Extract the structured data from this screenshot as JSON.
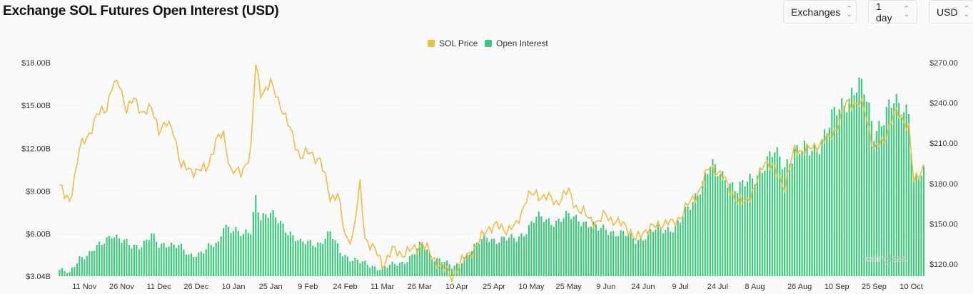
{
  "header": {
    "title": "Exchange SOL Futures Open Interest (USD)",
    "exchanges_label": "Exchanges",
    "interval_label": "1 day",
    "currency_label": "USD"
  },
  "watermark": "coinglass",
  "colors": {
    "price": "#f0bc44",
    "oi": "#3cc97c",
    "grid": "#eeeeee"
  },
  "chart_data": {
    "type": "bar",
    "title": "Exchange SOL Futures Open Interest (USD)",
    "legend": {
      "placement": "top-center",
      "entries": [
        "SOL Price",
        "Open Interest"
      ]
    },
    "grid": true,
    "x_tick_labels": [
      "11 Nov",
      "26 Nov",
      "11 Dec",
      "26 Dec",
      "10 Jan",
      "25 Jan",
      "9 Feb",
      "24 Feb",
      "11 Mar",
      "26 Mar",
      "10 Apr",
      "25 Apr",
      "10 May",
      "25 May",
      "9 Jun",
      "24 Jun",
      "9 Jul",
      "24 Jul",
      "8 Aug",
      "26 Aug",
      "10 Sep",
      "25 Sep",
      "10 Oct"
    ],
    "y_left": {
      "label": "",
      "ticks": [
        "$3.04B",
        "$6.00B",
        "$9.00B",
        "$12.00B",
        "$15.00B",
        "$18.00B"
      ],
      "range": [
        3.04,
        18.0
      ],
      "unit": "B USD"
    },
    "y_right": {
      "label": "",
      "ticks": [
        "$120.00",
        "$150.00",
        "$180.00",
        "$210.00",
        "$240.00",
        "$270.00"
      ],
      "range": [
        111,
        270
      ],
      "unit": "USD"
    },
    "series": [
      {
        "name": "Open Interest",
        "type": "bar",
        "axis": "left",
        "keyframes": [
          [
            "2024-11-01",
            3.5
          ],
          [
            "2024-11-05",
            3.2
          ],
          [
            "2024-11-09",
            4.4
          ],
          [
            "2024-11-13",
            4.6
          ],
          [
            "2024-11-18",
            5.3
          ],
          [
            "2024-11-22",
            6.1
          ],
          [
            "2024-11-26",
            5.5
          ],
          [
            "2024-11-30",
            5.1
          ],
          [
            "2024-12-04",
            5.3
          ],
          [
            "2024-12-08",
            5.9
          ],
          [
            "2024-12-11",
            5.1
          ],
          [
            "2024-12-15",
            5.4
          ],
          [
            "2024-12-19",
            5.2
          ],
          [
            "2024-12-23",
            4.4
          ],
          [
            "2024-12-27",
            4.7
          ],
          [
            "2024-12-31",
            5.1
          ],
          [
            "2025-01-04",
            5.2
          ],
          [
            "2025-01-06",
            6.7
          ],
          [
            "2025-01-10",
            6.4
          ],
          [
            "2025-01-14",
            5.8
          ],
          [
            "2025-01-17",
            6.2
          ],
          [
            "2025-01-19",
            8.7
          ],
          [
            "2025-01-21",
            7.3
          ],
          [
            "2025-01-25",
            7.3
          ],
          [
            "2025-01-29",
            6.8
          ],
          [
            "2025-02-02",
            6.1
          ],
          [
            "2025-02-06",
            5.3
          ],
          [
            "2025-02-10",
            5.4
          ],
          [
            "2025-02-14",
            5.4
          ],
          [
            "2025-02-18",
            6.0
          ],
          [
            "2025-02-22",
            4.8
          ],
          [
            "2025-02-26",
            4.3
          ],
          [
            "2025-03-02",
            4.0
          ],
          [
            "2025-03-06",
            3.8
          ],
          [
            "2025-03-11",
            3.6
          ],
          [
            "2025-03-15",
            3.8
          ],
          [
            "2025-03-19",
            4.0
          ],
          [
            "2025-03-23",
            4.5
          ],
          [
            "2025-03-27",
            5.3
          ],
          [
            "2025-03-31",
            4.4
          ],
          [
            "2025-04-04",
            4.2
          ],
          [
            "2025-04-08",
            3.6
          ],
          [
            "2025-04-10",
            3.8
          ],
          [
            "2025-04-14",
            4.6
          ],
          [
            "2025-04-18",
            5.2
          ],
          [
            "2025-04-22",
            5.8
          ],
          [
            "2025-04-26",
            5.6
          ],
          [
            "2025-04-30",
            5.6
          ],
          [
            "2025-05-04",
            5.7
          ],
          [
            "2025-05-08",
            6.3
          ],
          [
            "2025-05-12",
            7.1
          ],
          [
            "2025-05-16",
            7.0
          ],
          [
            "2025-05-20",
            6.9
          ],
          [
            "2025-05-25",
            7.2
          ],
          [
            "2025-05-29",
            7.1
          ],
          [
            "2025-06-02",
            6.7
          ],
          [
            "2025-06-06",
            6.3
          ],
          [
            "2025-06-09",
            6.4
          ],
          [
            "2025-06-13",
            6.1
          ],
          [
            "2025-06-17",
            5.9
          ],
          [
            "2025-06-21",
            5.6
          ],
          [
            "2025-06-24",
            5.8
          ],
          [
            "2025-06-28",
            6.2
          ],
          [
            "2025-07-02",
            6.3
          ],
          [
            "2025-07-06",
            6.5
          ],
          [
            "2025-07-09",
            6.9
          ],
          [
            "2025-07-13",
            7.9
          ],
          [
            "2025-07-17",
            9.4
          ],
          [
            "2025-07-21",
            10.8
          ],
          [
            "2025-07-24",
            10.2
          ],
          [
            "2025-07-28",
            9.9
          ],
          [
            "2025-08-01",
            9.1
          ],
          [
            "2025-08-04",
            9.4
          ],
          [
            "2025-08-08",
            10.1
          ],
          [
            "2025-08-12",
            10.9
          ],
          [
            "2025-08-16",
            11.6
          ],
          [
            "2025-08-20",
            10.9
          ],
          [
            "2025-08-24",
            11.8
          ],
          [
            "2025-08-26",
            11.7
          ],
          [
            "2025-08-30",
            11.9
          ],
          [
            "2025-09-03",
            12.4
          ],
          [
            "2025-09-07",
            13.5
          ],
          [
            "2025-09-10",
            14.6
          ],
          [
            "2025-09-14",
            15.6
          ],
          [
            "2025-09-18",
            16.2
          ],
          [
            "2025-09-21",
            15.9
          ],
          [
            "2025-09-25",
            13.4
          ],
          [
            "2025-09-29",
            14.1
          ],
          [
            "2025-10-03",
            15.1
          ],
          [
            "2025-10-06",
            15.0
          ],
          [
            "2025-10-09",
            14.9
          ],
          [
            "2025-10-11",
            9.6
          ],
          [
            "2025-10-15",
            10.2
          ]
        ]
      },
      {
        "name": "SOL Price",
        "type": "line",
        "axis": "right",
        "keyframes": [
          [
            "2024-11-01",
            179
          ],
          [
            "2024-11-03",
            170
          ],
          [
            "2024-11-05",
            167
          ],
          [
            "2024-11-07",
            185
          ],
          [
            "2024-11-09",
            205
          ],
          [
            "2024-11-13",
            218
          ],
          [
            "2024-11-16",
            230
          ],
          [
            "2024-11-20",
            237
          ],
          [
            "2024-11-22",
            252
          ],
          [
            "2024-11-25",
            254
          ],
          [
            "2024-11-28",
            236
          ],
          [
            "2024-12-01",
            242
          ],
          [
            "2024-12-04",
            234
          ],
          [
            "2024-12-08",
            235
          ],
          [
            "2024-12-11",
            221
          ],
          [
            "2024-12-14",
            224
          ],
          [
            "2024-12-17",
            219
          ],
          [
            "2024-12-20",
            193
          ],
          [
            "2024-12-23",
            190
          ],
          [
            "2024-12-26",
            190
          ],
          [
            "2024-12-30",
            190
          ],
          [
            "2025-01-03",
            212
          ],
          [
            "2025-01-06",
            216
          ],
          [
            "2025-01-09",
            190
          ],
          [
            "2025-01-13",
            187
          ],
          [
            "2025-01-17",
            204
          ],
          [
            "2025-01-19",
            268
          ],
          [
            "2025-01-21",
            248
          ],
          [
            "2025-01-25",
            254
          ],
          [
            "2025-01-29",
            239
          ],
          [
            "2025-02-02",
            219
          ],
          [
            "2025-02-06",
            200
          ],
          [
            "2025-02-10",
            203
          ],
          [
            "2025-02-14",
            197
          ],
          [
            "2025-02-18",
            170
          ],
          [
            "2025-02-21",
            172
          ],
          [
            "2025-02-24",
            140
          ],
          [
            "2025-02-27",
            140
          ],
          [
            "2025-03-02",
            178
          ],
          [
            "2025-03-04",
            140
          ],
          [
            "2025-03-08",
            130
          ],
          [
            "2025-03-11",
            120
          ],
          [
            "2025-03-15",
            130
          ],
          [
            "2025-03-19",
            128
          ],
          [
            "2025-03-23",
            130
          ],
          [
            "2025-03-27",
            136
          ],
          [
            "2025-03-31",
            125
          ],
          [
            "2025-04-04",
            118
          ],
          [
            "2025-04-08",
            111
          ],
          [
            "2025-04-10",
            116
          ],
          [
            "2025-04-14",
            127
          ],
          [
            "2025-04-18",
            133
          ],
          [
            "2025-04-22",
            147
          ],
          [
            "2025-04-26",
            148
          ],
          [
            "2025-04-30",
            146
          ],
          [
            "2025-05-04",
            148
          ],
          [
            "2025-05-08",
            170
          ],
          [
            "2025-05-12",
            172
          ],
          [
            "2025-05-16",
            170
          ],
          [
            "2025-05-20",
            166
          ],
          [
            "2025-05-25",
            174
          ],
          [
            "2025-05-29",
            160
          ],
          [
            "2025-06-02",
            155
          ],
          [
            "2025-06-06",
            150
          ],
          [
            "2025-06-09",
            158
          ],
          [
            "2025-06-13",
            150
          ],
          [
            "2025-06-17",
            150
          ],
          [
            "2025-06-21",
            137
          ],
          [
            "2025-06-24",
            145
          ],
          [
            "2025-06-28",
            147
          ],
          [
            "2025-07-02",
            151
          ],
          [
            "2025-07-06",
            150
          ],
          [
            "2025-07-09",
            156
          ],
          [
            "2025-07-13",
            166
          ],
          [
            "2025-07-17",
            176
          ],
          [
            "2025-07-21",
            194
          ],
          [
            "2025-07-24",
            188
          ],
          [
            "2025-07-28",
            180
          ],
          [
            "2025-08-01",
            165
          ],
          [
            "2025-08-04",
            167
          ],
          [
            "2025-08-08",
            176
          ],
          [
            "2025-08-12",
            198
          ],
          [
            "2025-08-16",
            190
          ],
          [
            "2025-08-20",
            178
          ],
          [
            "2025-08-24",
            205
          ],
          [
            "2025-08-26",
            205
          ],
          [
            "2025-08-30",
            205
          ],
          [
            "2025-09-03",
            210
          ],
          [
            "2025-09-07",
            214
          ],
          [
            "2025-09-10",
            222
          ],
          [
            "2025-09-14",
            240
          ],
          [
            "2025-09-18",
            240
          ],
          [
            "2025-09-21",
            236
          ],
          [
            "2025-09-25",
            205
          ],
          [
            "2025-09-29",
            212
          ],
          [
            "2025-10-03",
            232
          ],
          [
            "2025-10-06",
            230
          ],
          [
            "2025-10-09",
            222
          ],
          [
            "2025-10-11",
            180
          ],
          [
            "2025-10-15",
            194
          ]
        ]
      }
    ]
  }
}
